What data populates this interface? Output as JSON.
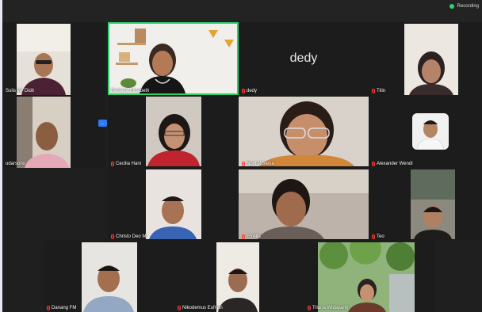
{
  "window": {
    "recording_label": "Recording"
  },
  "participants": [
    {
      "id": "sulis",
      "name": "Sulis W- Didit",
      "muted": false,
      "speaking": false
    },
    {
      "id": "berliana",
      "name": "Berliana Elisabeth",
      "muted": false,
      "speaking": true
    },
    {
      "id": "dedy",
      "name": "dedy",
      "display_text": "dedy",
      "muted": true,
      "speaking": false
    },
    {
      "id": "titin",
      "name": "Titin",
      "muted": true,
      "speaking": false
    },
    {
      "id": "sudarsono",
      "name": "udarsono",
      "muted": false,
      "speaking": false
    },
    {
      "id": "cecilia",
      "name": "Cecilia Hani",
      "muted": true,
      "speaking": false
    },
    {
      "id": "noni",
      "name": "Noni Novena",
      "muted": true,
      "speaking": false
    },
    {
      "id": "alexander",
      "name": "Alexander Wendi",
      "muted": true,
      "speaking": false
    },
    {
      "id": "christo",
      "name": "Christo Deo M",
      "muted": true,
      "speaking": false
    },
    {
      "id": "emillia",
      "name": "Emillia",
      "muted": true,
      "speaking": false
    },
    {
      "id": "teo",
      "name": "Teo",
      "muted": true,
      "speaking": false
    },
    {
      "id": "danang",
      "name": "Danang FM",
      "muted": true,
      "speaking": false
    },
    {
      "id": "nikodemus",
      "name": "Nikodemus Eufrian",
      "muted": true,
      "speaking": false
    },
    {
      "id": "triana",
      "name": "Triana Widayanti",
      "muted": true,
      "speaking": false
    }
  ],
  "colors": {
    "active_speaker_border": "#2bd06b",
    "muted_icon": "#ff3b30",
    "background": "#1f1f1f"
  },
  "badge": {
    "label": "..."
  }
}
